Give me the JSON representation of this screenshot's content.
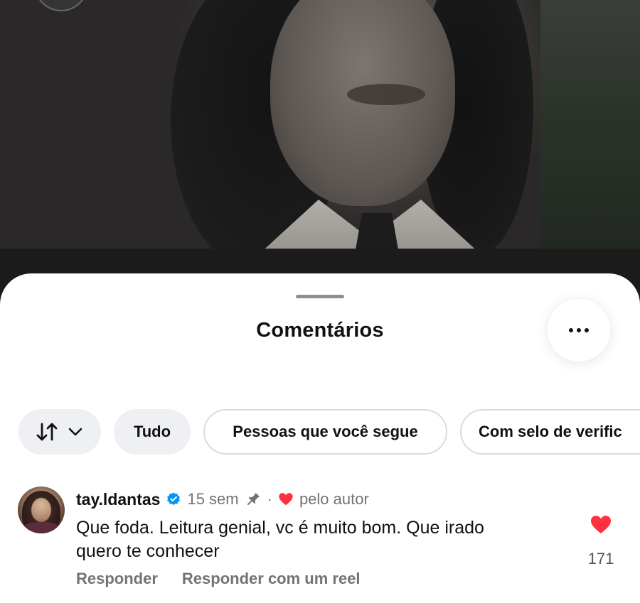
{
  "sheet": {
    "title": "Comentários"
  },
  "filters": {
    "sort_icon": "sort-arrows-icon",
    "chips": [
      {
        "label": "Tudo"
      },
      {
        "label": "Pessoas que você segue"
      },
      {
        "label": "Com selo de verific"
      }
    ]
  },
  "comment": {
    "username": "tay.ldantas",
    "time": "15 sem",
    "dot": "·",
    "liked_by_author": "pelo autor",
    "text_line1": "Que foda. Leitura genial, vc é muito bom. Que irado",
    "text_line2": "quero te conhecer",
    "like_count": "171",
    "reply_label": "Responder",
    "reply_reel_label": "Responder com um reel"
  },
  "colors": {
    "like_red": "#ff3040",
    "verified_blue": "#0095f6"
  }
}
